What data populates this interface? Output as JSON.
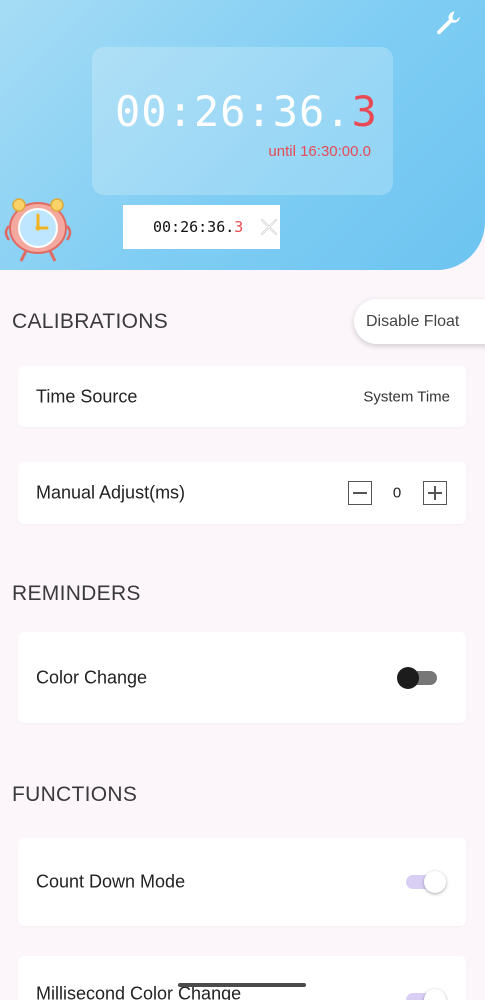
{
  "header": {
    "timer": {
      "main": "00:26:36.",
      "tenth": "3"
    },
    "until_text": "until 16:30:00.0",
    "float_widget": {
      "main": "00:26:36.",
      "tenth": "3"
    },
    "icons": {
      "settings": "wrench-icon",
      "mascot": "alarm-clock-mascot-icon",
      "close": "close-icon"
    }
  },
  "calibrations": {
    "title": "CALIBRATIONS",
    "disable_float_label": "Disable Float",
    "time_source": {
      "label": "Time Source",
      "value": "System Time"
    },
    "manual_adjust": {
      "label": "Manual Adjust(ms)",
      "value": "0"
    }
  },
  "reminders": {
    "title": "REMINDERS",
    "color_change": {
      "label": "Color Change",
      "enabled": false
    }
  },
  "functions": {
    "title": "FUNCTIONS",
    "count_down_mode": {
      "label": "Count Down Mode",
      "enabled": true
    },
    "millisecond_color_change": {
      "label": "Millisecond Color Change",
      "enabled": true
    }
  },
  "colors": {
    "header_gradient_start": "#a6dcf5",
    "header_gradient_end": "#6cc4f0",
    "accent_red": "#e84a55",
    "page_background": "#fcf6fb"
  }
}
